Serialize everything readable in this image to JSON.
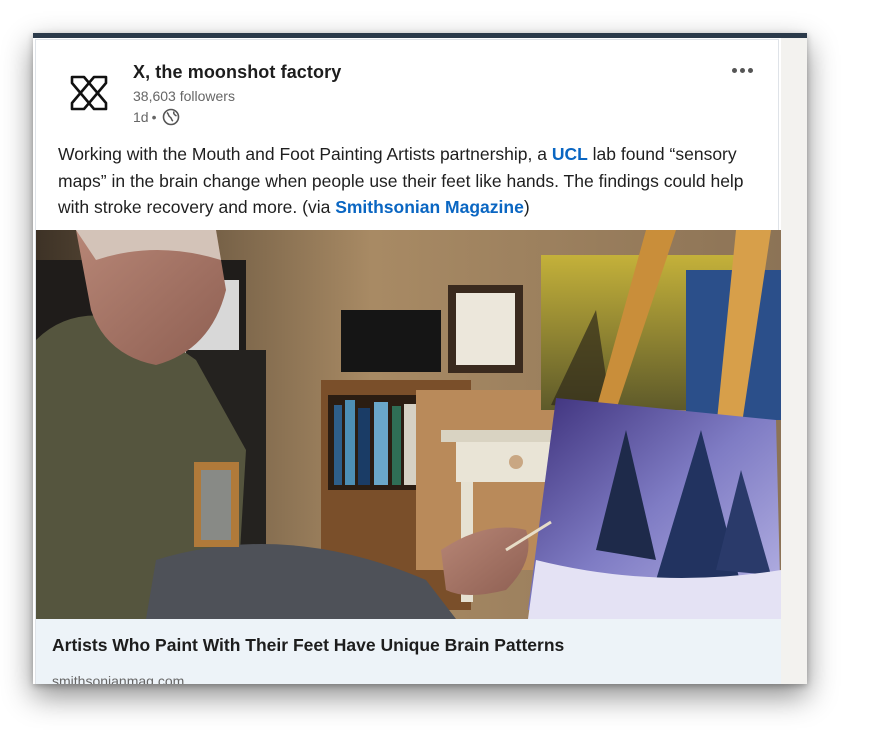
{
  "post": {
    "company_name": "X, the moonshot factory",
    "followers": "38,603 followers",
    "age": "1d",
    "separator": "•",
    "text_before_ucl": "Working with the Mouth and Foot Painting Artists partnership, a ",
    "ucl_link": "UCL",
    "text_after_ucl": " lab found “sensory maps” in the brain change when people use their feet like hands. The findings could help with stroke recovery and more. (via ",
    "source_link": "Smithsonian Magazine",
    "text_close": ")",
    "more_icon": "ellipsis-icon",
    "visibility_icon": "globe-icon"
  },
  "article": {
    "title": "Artists Who Paint With Their Feet Have Unique Brain Patterns",
    "domain": "smithsonianmag.com"
  },
  "colors": {
    "link": "#0a66c2",
    "top_bar": "#2b3a4a",
    "link_bar_bg": "#edf3f8"
  }
}
